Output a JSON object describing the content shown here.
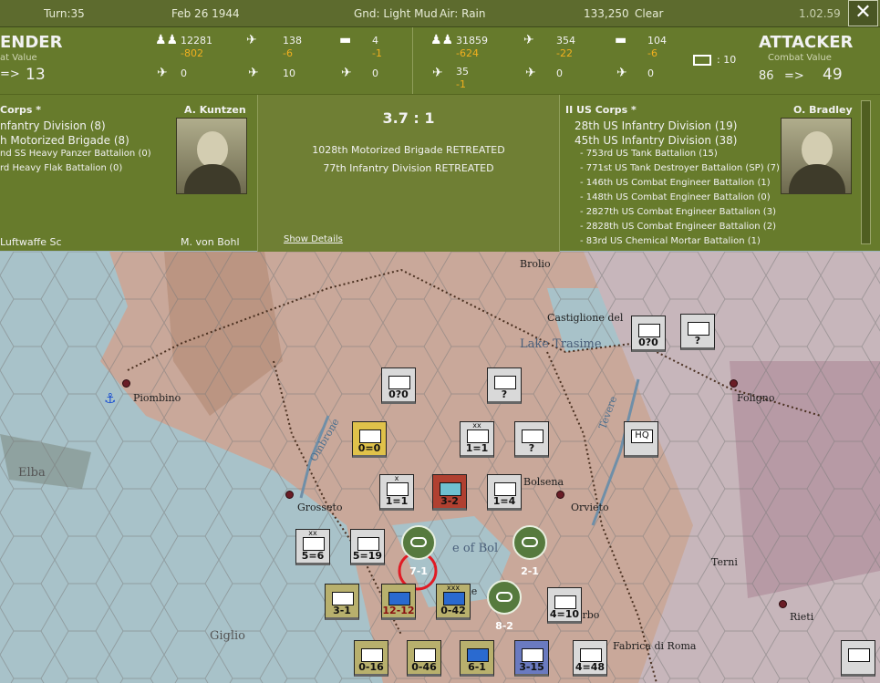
{
  "topbar": {
    "turn": "Turn:35",
    "date": "Feb 26 1944",
    "ground": "Gnd: Light Mud",
    "air": "Air: Rain",
    "score": "133,250",
    "weather": "Clear",
    "version": "1.02.59",
    "close": "✕"
  },
  "defender": {
    "title": "ENDER",
    "sub": "at Value",
    "arrow": "=>",
    "value": "13",
    "infantry": "12281",
    "infantry_loss": "-802",
    "planes": "138",
    "planes_loss": "-6",
    "tanks": "4",
    "tanks_loss": "-1",
    "row2_a": "0",
    "row2_b": "10",
    "row2_c": "0"
  },
  "attacker": {
    "title": "ATTACKER",
    "sub": "Combat Value",
    "start": "86",
    "arrow": "=>",
    "value": "49",
    "infantry": "31859",
    "infantry_loss": "-624",
    "planes": "354",
    "planes_loss": "-22",
    "tanks": "104",
    "tanks_loss": "-6",
    "row2_a": "35",
    "row2_a_loss": "-1",
    "row2_b": "0",
    "row2_c": "0",
    "ratio_label": ": 10"
  },
  "left_panel": {
    "corps": "Corps *",
    "commander": "A. Kuntzen",
    "units": [
      "nfantry Division (8)",
      "h Motorized Brigade (8)",
      "nd SS Heavy Panzer Battalion (0)",
      "rd Heavy Flak Battalion (0)"
    ],
    "footer_a": "Luftwaffe Sc",
    "footer_b": "M. von Bohl"
  },
  "mid_panel": {
    "ratio": "3.7 : 1",
    "result1": "1028th Motorized Brigade RETREATED",
    "result2": "77th Infantry Division RETREATED",
    "show_details": "Show Details"
  },
  "right_panel": {
    "corps": "II US Corps *",
    "commander": "O. Bradley",
    "divisions": [
      "28th US Infantry Division (19)",
      "45th US Infantry Division (38)"
    ],
    "units": [
      "- 753rd US Tank Battalion (15)",
      "- 771st US Tank Destroyer Battalion (SP) (7)",
      "- 146th US Combat Engineer Battalion (1)",
      "- 148th US Combat Engineer Battalion (0)",
      "- 2827th US Combat Engineer Battalion (3)",
      "- 2828th US Combat Engineer Battalion (2)",
      "- 83rd US Chemical Mortar Battalion (1)"
    ]
  },
  "map": {
    "places": [
      "Brolio",
      "Castiglione del",
      "Lake Trasime",
      "Piombino",
      "Foligno",
      "Elba",
      "Grosseto",
      "Orvieto",
      "Bolsena",
      "Terni",
      "Rieti",
      "Giglio",
      "Ombrone",
      "Tevere",
      "e of Bol",
      "erbo",
      "Fabrica di Roma",
      "rle"
    ],
    "units": [
      "0?0",
      "?",
      "0?0",
      "?",
      "1=1",
      "?",
      "HQ",
      "0=0",
      "1=1",
      "3-2",
      "1=4",
      "5=6",
      "5=19",
      "7-1",
      "2-1",
      "3-1",
      "12-12",
      "0-42",
      "8-2",
      "4=10",
      "0-16",
      "0-46",
      "6-1",
      "3-15",
      "4=48",
      "xx",
      "x",
      "xxx"
    ]
  }
}
